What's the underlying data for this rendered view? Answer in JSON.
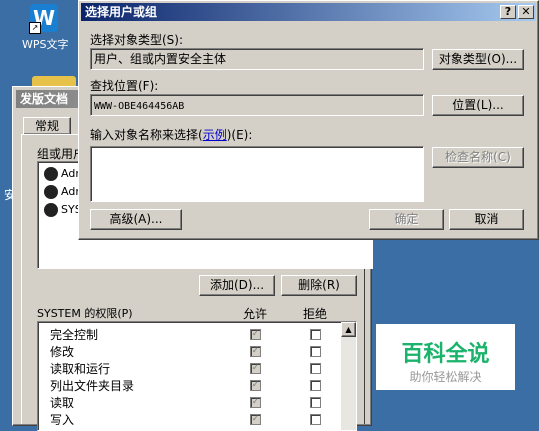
{
  "desktop": {
    "wps_icon_letter": "W",
    "wps_icon_label": "WPS文字",
    "side_char": "安"
  },
  "back_dialog": {
    "title": "发版文档",
    "tab_general": "常规",
    "group_label": "组或用户",
    "users": [
      "Adm",
      "Adm",
      "SYS"
    ],
    "add_button": "添加(D)...",
    "remove_button": "删除(R)",
    "perm_header": "SYSTEM 的权限(P)",
    "allow_header": "允许",
    "deny_header": "拒绝",
    "permissions": [
      {
        "name": "完全控制",
        "allow": true,
        "deny": false
      },
      {
        "name": "修改",
        "allow": true,
        "deny": false
      },
      {
        "name": "读取和运行",
        "allow": true,
        "deny": false
      },
      {
        "name": "列出文件夹目录",
        "allow": true,
        "deny": false
      },
      {
        "name": "读取",
        "allow": true,
        "deny": false
      },
      {
        "name": "写入",
        "allow": true,
        "deny": false
      }
    ]
  },
  "dialog": {
    "title": "选择用户或组",
    "help_btn": "?",
    "close_btn": "✕",
    "object_type_label": "选择对象类型(S):",
    "object_type_value": "用户、组或内置安全主体",
    "object_type_button": "对象类型(O)...",
    "location_label": "查找位置(F):",
    "location_value": "WWW-OBE464456AB",
    "location_button": "位置(L)...",
    "enter_label_pre": "输入对象名称来选择(",
    "enter_label_link": "示例",
    "enter_label_post": ")(E):",
    "check_names_button": "检查名称(C)",
    "advanced_button": "高级(A)...",
    "ok_button": "确定",
    "cancel_button": "取消"
  },
  "watermark": {
    "title": "百科全说",
    "subtitle": "助你轻松解决"
  }
}
